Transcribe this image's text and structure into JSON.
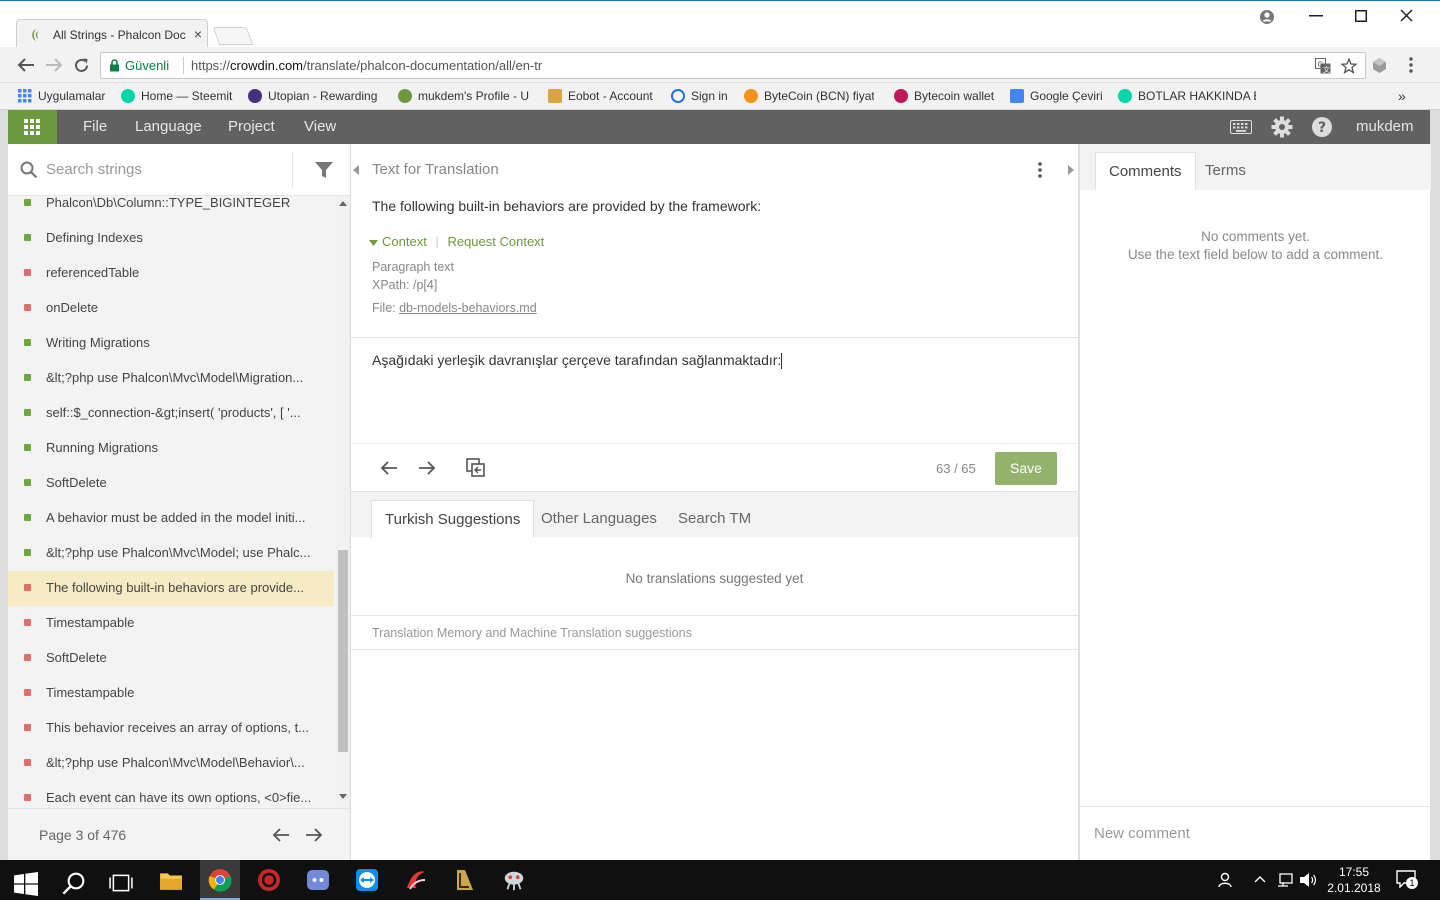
{
  "browser": {
    "tab_title": "All Strings - Phalcon Doc",
    "tab_close": "×",
    "secure_label": "Güvenli",
    "url_prefix": "https://",
    "url_host": "crowdin.com",
    "url_path": "/translate/phalcon-documentation/all/en-tr"
  },
  "bookmarks": [
    {
      "label": "Uygulamalar",
      "color": "#4285f4"
    },
    {
      "label": "Home — Steemit",
      "color": "#06d6a9"
    },
    {
      "label": "Utopian - Rewarding",
      "color": "#4b2f7f"
    },
    {
      "label": "mukdem's Profile - U",
      "color": "#6d9a3c"
    },
    {
      "label": "Eobot - Account",
      "color": "#d9a441"
    },
    {
      "label": "Sign in",
      "color": "#1a73e8"
    },
    {
      "label": "ByteCoin (BCN) fiyatı",
      "color": "#f7931a"
    },
    {
      "label": "Bytecoin wallet",
      "color": "#c2185b"
    },
    {
      "label": "Google Çeviri",
      "color": "#4285f4"
    },
    {
      "label": "BOTLAR HAKKINDA E",
      "color": "#06d6a9"
    },
    {
      "label": "»",
      "color": ""
    }
  ],
  "appbar": {
    "menu": [
      "File",
      "Language",
      "Project",
      "View"
    ],
    "username": "mukdem"
  },
  "left": {
    "search_placeholder": "Search strings",
    "strings": [
      {
        "text": "Phalcon\\Db\\Column::TYPE_BIGINTEGER",
        "status": "green"
      },
      {
        "text": "Defining Indexes",
        "status": "green"
      },
      {
        "text": "referencedTable",
        "status": "red"
      },
      {
        "text": "onDelete",
        "status": "red"
      },
      {
        "text": "Writing Migrations",
        "status": "green"
      },
      {
        "text": "&lt;?php use Phalcon\\Mvc\\Model\\Migration...",
        "status": "green"
      },
      {
        "text": "self::$_connection-&gt;insert( 'products', [ '...",
        "status": "green"
      },
      {
        "text": "Running Migrations",
        "status": "green"
      },
      {
        "text": "SoftDelete",
        "status": "green"
      },
      {
        "text": "A behavior must be added in the model initi...",
        "status": "green"
      },
      {
        "text": "&lt;?php use Phalcon\\Mvc\\Model; use Phalc...",
        "status": "green"
      },
      {
        "text": "The following built-in behaviors are provide...",
        "status": "red",
        "selected": true
      },
      {
        "text": "Timestampable",
        "status": "red"
      },
      {
        "text": "SoftDelete",
        "status": "red"
      },
      {
        "text": "Timestampable",
        "status": "red"
      },
      {
        "text": "This behavior receives an array of options, t...",
        "status": "red"
      },
      {
        "text": "&lt;?php use Phalcon\\Mvc\\Model\\Behavior\\...",
        "status": "red"
      },
      {
        "text": "Each event can have its own options, <0>fie...",
        "status": "red"
      }
    ],
    "pager": "Page 3 of 476"
  },
  "center": {
    "header": "Text for Translation",
    "source_text": "The following built-in behaviors are provided by the framework:",
    "context_toggle": "Context",
    "context_sep": "|",
    "request_context": "Request Context",
    "meta_type": "Paragraph text",
    "meta_xpath": "XPath: /p[4]",
    "meta_file_label": "File: ",
    "meta_file": "db-models-behaviors.md",
    "translation": "Aşağıdaki yerleşik davranışlar çerçeve tarafından sağlanmaktadır:",
    "counter": "63 / 65",
    "save": "Save",
    "suggestion_tabs": [
      "Turkish Suggestions",
      "Other Languages",
      "Search TM"
    ],
    "no_suggestions": "No translations suggested yet",
    "tm_label": "Translation Memory and Machine Translation suggestions"
  },
  "right": {
    "tabs": [
      "Comments",
      "Terms"
    ],
    "no_comments_1": "No comments yet.",
    "no_comments_2": "Use the text field below to add a comment.",
    "new_comment_placeholder": "New comment"
  },
  "taskbar": {
    "time": "17:55",
    "date": "2.01.2018",
    "notification_count": "1"
  },
  "colors": {
    "accent_green": "#6d9a3c",
    "status_green": "#6da93f",
    "status_red": "#e06c6c",
    "selected_row": "#f6ebc4",
    "save_button": "#93b26b"
  }
}
